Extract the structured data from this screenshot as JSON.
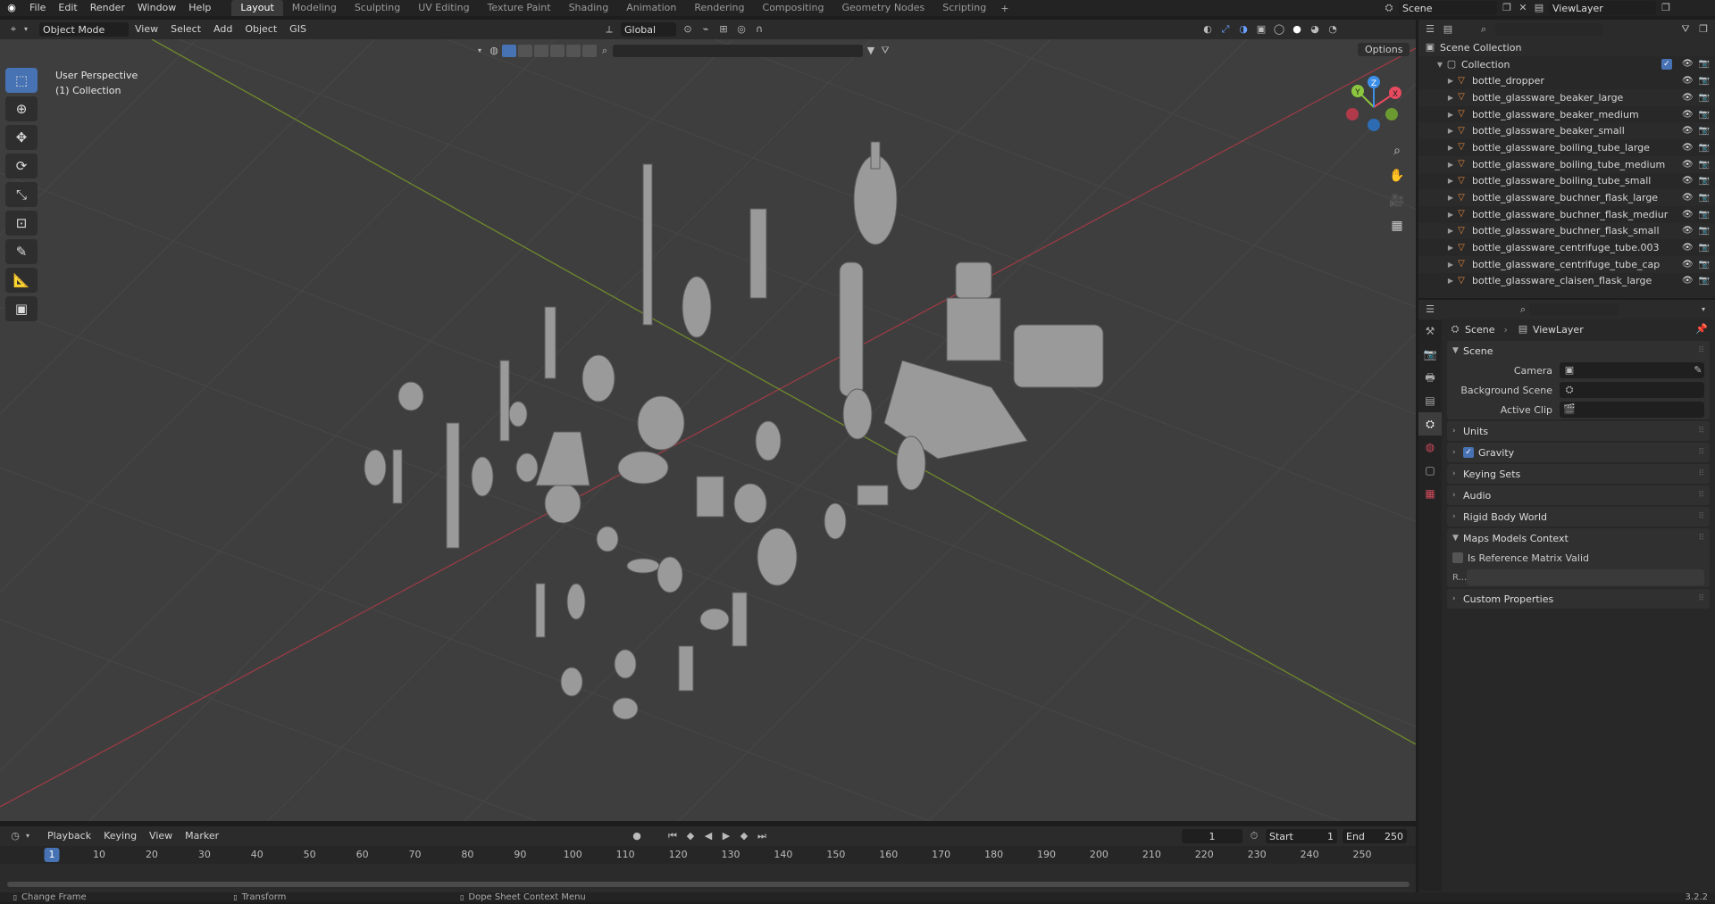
{
  "menu": {
    "items": [
      "File",
      "Edit",
      "Render",
      "Window",
      "Help"
    ]
  },
  "workspaces": [
    "Layout",
    "Modeling",
    "Sculpting",
    "UV Editing",
    "Texture Paint",
    "Shading",
    "Animation",
    "Rendering",
    "Compositing",
    "Geometry Nodes",
    "Scripting"
  ],
  "active_workspace": "Layout",
  "scene_selector": {
    "label": "Scene"
  },
  "viewlayer_selector": {
    "label": "ViewLayer"
  },
  "viewport_header": {
    "mode": "Object Mode",
    "menus": [
      "View",
      "Select",
      "Add",
      "Object",
      "GIS"
    ],
    "transform_orientation": "Global",
    "options_label": "Options"
  },
  "viewport": {
    "line1": "User Perspective",
    "line2": "(1) Collection"
  },
  "gizmo": {
    "x": "X",
    "y": "Y",
    "z": "Z",
    "x_color": "#e84a5f",
    "y_color": "#8cc63f",
    "z_color": "#3c8ee8"
  },
  "outliner": {
    "root": "Scene Collection",
    "collection": "Collection",
    "objects": [
      "bottle_dropper",
      "bottle_glassware_beaker_large",
      "bottle_glassware_beaker_medium",
      "bottle_glassware_beaker_small",
      "bottle_glassware_boiling_tube_large",
      "bottle_glassware_boiling_tube_medium",
      "bottle_glassware_boiling_tube_small",
      "bottle_glassware_buchner_flask_large",
      "bottle_glassware_buchner_flask_mediur",
      "bottle_glassware_buchner_flask_small",
      "bottle_glassware_centrifuge_tube.003",
      "bottle_glassware_centrifuge_tube_cap",
      "bottle_glassware_claisen_flask_large"
    ]
  },
  "properties": {
    "breadcrumb": [
      "Scene",
      "ViewLayer"
    ],
    "scene_panel": "Scene",
    "fields": [
      {
        "label": "Camera",
        "value": ""
      },
      {
        "label": "Background Scene",
        "value": ""
      },
      {
        "label": "Active Clip",
        "value": ""
      }
    ],
    "panels": [
      "Units",
      "Gravity",
      "Keying Sets",
      "Audio",
      "Rigid Body World",
      "Maps Models Context"
    ],
    "gravity_checked": true,
    "maps_checkbox": "Is Reference Matrix Valid",
    "matrix_label": "R...",
    "custom_properties": "Custom Properties"
  },
  "timeline": {
    "menus": [
      "Playback",
      "Keying",
      "View",
      "Marker"
    ],
    "current_frame": "1",
    "start_label": "Start",
    "start": "1",
    "end_label": "End",
    "end": "250",
    "ticks": [
      "1",
      "10",
      "20",
      "30",
      "40",
      "50",
      "60",
      "70",
      "80",
      "90",
      "100",
      "110",
      "120",
      "130",
      "140",
      "150",
      "160",
      "170",
      "180",
      "190",
      "200",
      "210",
      "220",
      "230",
      "240",
      "250"
    ],
    "playhead": "1"
  },
  "status": {
    "items": [
      "Change Frame",
      "Transform",
      "Dope Sheet Context Menu"
    ],
    "version": "3.2.2"
  },
  "colors": {
    "accent": "#4772b3",
    "x_axis": "#b8394a",
    "y_axis": "#7a9a2a",
    "mesh_icon": "#e2883d"
  }
}
